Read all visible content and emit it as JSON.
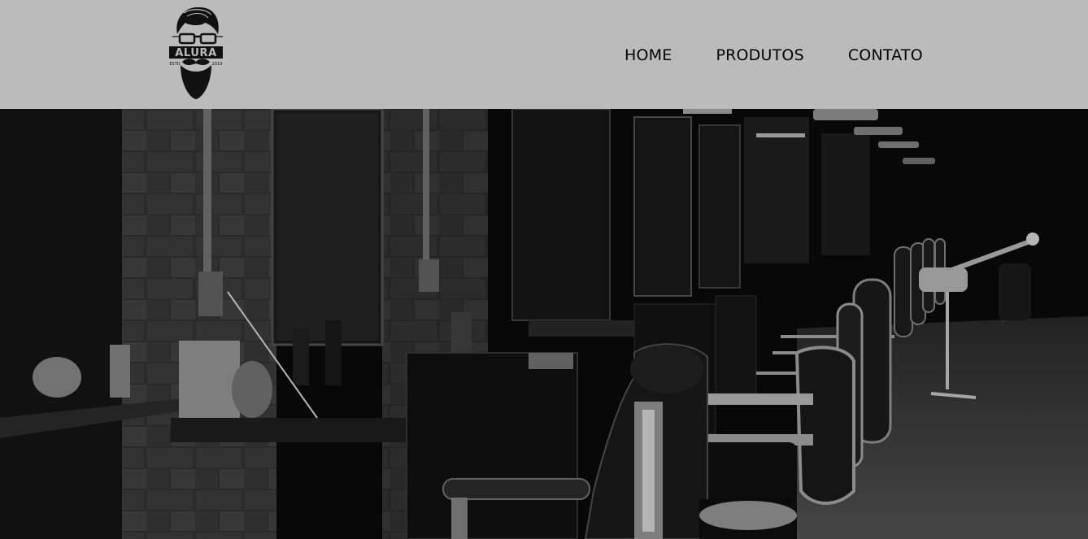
{
  "header": {
    "logo": {
      "brand_text": "ALURA",
      "estd_label": "ESTD",
      "year_label": "2019",
      "icon": "bearded-man-logo-icon"
    },
    "nav": [
      {
        "label": "HOME"
      },
      {
        "label": "PRODUTOS"
      },
      {
        "label": "CONTATO"
      }
    ]
  },
  "hero": {
    "image": "barbershop-interior-photo",
    "style": "black-and-white"
  },
  "colors": {
    "header_bg": "#bbbbbb",
    "nav_text": "#000000"
  }
}
